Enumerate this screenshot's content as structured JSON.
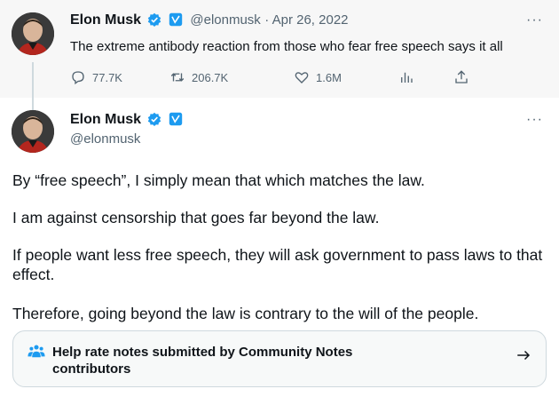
{
  "quoted": {
    "author_name": "Elon Musk",
    "handle": "@elonmusk",
    "date": "· Apr 26, 2022",
    "text": "The extreme antibody reaction from those who fear free speech says it all",
    "replies": "77.7K",
    "retweets": "206.7K",
    "likes": "1.6M",
    "views_icon": "bar-chart-icon",
    "share_icon": "share-icon",
    "more": "···"
  },
  "main": {
    "author_name": "Elon Musk",
    "handle": "@elonmusk",
    "more": "···",
    "paragraphs": [
      "By “free speech”, I simply mean that which matches the law.",
      "I am against censorship that goes far beyond the law.",
      "If people want less free speech, they will ask government to pass laws to that effect.",
      "Therefore, going beyond the law is contrary to the will of the people."
    ]
  },
  "community_notes": {
    "label": "Help rate notes submitted by Community Notes contributors",
    "icon": "people-icon",
    "arrow": "arrow-right-icon"
  },
  "colors": {
    "verified_blue": "#1d9bf0",
    "text_primary": "#0f1419",
    "text_secondary": "#536471"
  }
}
